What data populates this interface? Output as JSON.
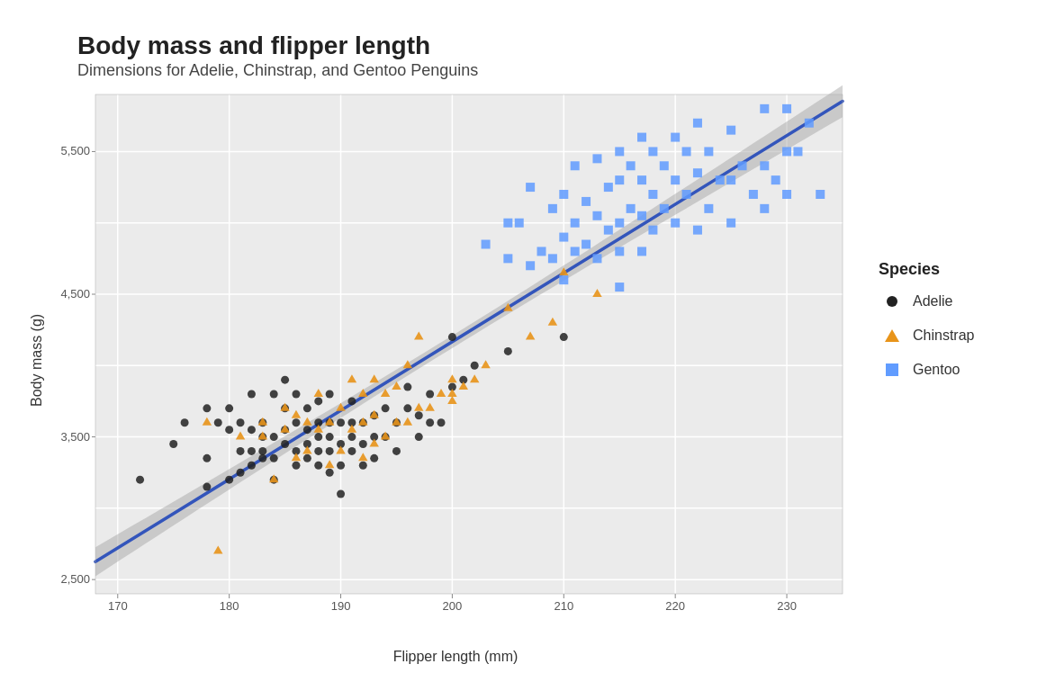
{
  "title": "Body mass and flipper length",
  "subtitle": "Dimensions for Adelie, Chinstrap, and Gentoo Penguins",
  "xAxisLabel": "Flipper length (mm)",
  "yAxisLabel": "Body mass (g)",
  "legendTitle": "Species",
  "legendItems": [
    {
      "label": "Adelie",
      "shape": "circle",
      "color": "#222222"
    },
    {
      "label": "Chinstrap",
      "shape": "triangle",
      "color": "#E8941A"
    },
    {
      "label": "Gentoo",
      "shape": "square",
      "color": "#619CFF"
    }
  ],
  "xTicks": [
    "170",
    "180",
    "190",
    "200",
    "210",
    "220",
    "230"
  ],
  "yTicks": [
    "2500",
    "3500",
    "4500",
    "5500"
  ],
  "colors": {
    "adelie": "#222222",
    "chinstrap": "#E8941A",
    "gentoo": "#619CFF",
    "trendline": "#3366CC",
    "ci": "rgba(150,150,150,0.4)",
    "gridBg": "#EBEBEB",
    "gridLine": "#ffffff"
  },
  "adeliePoints": [
    [
      172,
      3200
    ],
    [
      175,
      3450
    ],
    [
      176,
      3600
    ],
    [
      178,
      3150
    ],
    [
      178,
      3350
    ],
    [
      178,
      3700
    ],
    [
      179,
      3600
    ],
    [
      180,
      3200
    ],
    [
      180,
      3550
    ],
    [
      180,
      3700
    ],
    [
      181,
      3250
    ],
    [
      181,
      3400
    ],
    [
      181,
      3600
    ],
    [
      182,
      3300
    ],
    [
      182,
      3400
    ],
    [
      182,
      3550
    ],
    [
      182,
      3800
    ],
    [
      183,
      3350
    ],
    [
      183,
      3400
    ],
    [
      183,
      3500
    ],
    [
      183,
      3600
    ],
    [
      184,
      3200
    ],
    [
      184,
      3350
    ],
    [
      184,
      3500
    ],
    [
      184,
      3800
    ],
    [
      185,
      3450
    ],
    [
      185,
      3550
    ],
    [
      185,
      3700
    ],
    [
      185,
      3900
    ],
    [
      186,
      3300
    ],
    [
      186,
      3400
    ],
    [
      186,
      3600
    ],
    [
      186,
      3800
    ],
    [
      187,
      3350
    ],
    [
      187,
      3450
    ],
    [
      187,
      3550
    ],
    [
      187,
      3700
    ],
    [
      188,
      3300
    ],
    [
      188,
      3400
    ],
    [
      188,
      3500
    ],
    [
      188,
      3600
    ],
    [
      188,
      3750
    ],
    [
      189,
      3250
    ],
    [
      189,
      3400
    ],
    [
      189,
      3500
    ],
    [
      189,
      3600
    ],
    [
      189,
      3800
    ],
    [
      190,
      3100
    ],
    [
      190,
      3300
    ],
    [
      190,
      3450
    ],
    [
      190,
      3600
    ],
    [
      191,
      3400
    ],
    [
      191,
      3500
    ],
    [
      191,
      3600
    ],
    [
      191,
      3750
    ],
    [
      192,
      3300
    ],
    [
      192,
      3450
    ],
    [
      192,
      3600
    ],
    [
      193,
      3350
    ],
    [
      193,
      3500
    ],
    [
      193,
      3650
    ],
    [
      194,
      3500
    ],
    [
      194,
      3700
    ],
    [
      195,
      3400
    ],
    [
      195,
      3600
    ],
    [
      196,
      3700
    ],
    [
      196,
      3850
    ],
    [
      197,
      3500
    ],
    [
      197,
      3650
    ],
    [
      198,
      3600
    ],
    [
      198,
      3800
    ],
    [
      199,
      3600
    ],
    [
      200,
      4200
    ],
    [
      200,
      3850
    ],
    [
      201,
      3900
    ],
    [
      202,
      4000
    ],
    [
      205,
      4100
    ],
    [
      210,
      4200
    ]
  ],
  "chinStrapPoints": [
    [
      178,
      3600
    ],
    [
      179,
      2700
    ],
    [
      181,
      3500
    ],
    [
      183,
      3600
    ],
    [
      183,
      3500
    ],
    [
      184,
      3200
    ],
    [
      185,
      3550
    ],
    [
      185,
      3700
    ],
    [
      186,
      3350
    ],
    [
      186,
      3650
    ],
    [
      187,
      3400
    ],
    [
      187,
      3600
    ],
    [
      188,
      3550
    ],
    [
      188,
      3800
    ],
    [
      189,
      3300
    ],
    [
      189,
      3600
    ],
    [
      190,
      3400
    ],
    [
      190,
      3700
    ],
    [
      191,
      3550
    ],
    [
      191,
      3900
    ],
    [
      192,
      3350
    ],
    [
      192,
      3600
    ],
    [
      192,
      3800
    ],
    [
      193,
      3450
    ],
    [
      193,
      3650
    ],
    [
      193,
      3900
    ],
    [
      194,
      3500
    ],
    [
      194,
      3800
    ],
    [
      195,
      3600
    ],
    [
      195,
      3850
    ],
    [
      196,
      3600
    ],
    [
      196,
      4000
    ],
    [
      197,
      3700
    ],
    [
      197,
      4200
    ],
    [
      198,
      3700
    ],
    [
      199,
      3800
    ],
    [
      200,
      3750
    ],
    [
      200,
      3800
    ],
    [
      200,
      3900
    ],
    [
      201,
      3850
    ],
    [
      202,
      3900
    ],
    [
      203,
      4000
    ],
    [
      205,
      4400
    ],
    [
      207,
      4200
    ],
    [
      209,
      4300
    ],
    [
      210,
      4650
    ],
    [
      213,
      4500
    ]
  ],
  "gentooPoints": [
    [
      203,
      4850
    ],
    [
      205,
      5000
    ],
    [
      205,
      4750
    ],
    [
      206,
      5000
    ],
    [
      207,
      5250
    ],
    [
      207,
      4700
    ],
    [
      208,
      4800
    ],
    [
      209,
      5100
    ],
    [
      209,
      4750
    ],
    [
      210,
      4600
    ],
    [
      210,
      4900
    ],
    [
      210,
      5200
    ],
    [
      211,
      4800
    ],
    [
      211,
      5000
    ],
    [
      211,
      5400
    ],
    [
      212,
      4850
    ],
    [
      212,
      5150
    ],
    [
      213,
      4750
    ],
    [
      213,
      5050
    ],
    [
      213,
      5450
    ],
    [
      214,
      4950
    ],
    [
      214,
      5250
    ],
    [
      215,
      4800
    ],
    [
      215,
      5000
    ],
    [
      215,
      5300
    ],
    [
      215,
      5500
    ],
    [
      215,
      4550
    ],
    [
      216,
      5100
    ],
    [
      216,
      5400
    ],
    [
      217,
      4800
    ],
    [
      217,
      5050
    ],
    [
      217,
      5300
    ],
    [
      217,
      5600
    ],
    [
      218,
      4950
    ],
    [
      218,
      5200
    ],
    [
      218,
      5500
    ],
    [
      219,
      5100
    ],
    [
      219,
      5400
    ],
    [
      220,
      5000
    ],
    [
      220,
      5300
    ],
    [
      220,
      5600
    ],
    [
      221,
      5200
    ],
    [
      221,
      5500
    ],
    [
      222,
      4950
    ],
    [
      222,
      5350
    ],
    [
      222,
      5700
    ],
    [
      223,
      5100
    ],
    [
      223,
      5500
    ],
    [
      224,
      5300
    ],
    [
      225,
      5000
    ],
    [
      225,
      5300
    ],
    [
      225,
      5650
    ],
    [
      226,
      5400
    ],
    [
      227,
      5200
    ],
    [
      228,
      5100
    ],
    [
      228,
      5400
    ],
    [
      228,
      5800
    ],
    [
      229,
      5300
    ],
    [
      230,
      5200
    ],
    [
      230,
      5500
    ],
    [
      230,
      5800
    ],
    [
      231,
      5500
    ],
    [
      232,
      5700
    ],
    [
      233,
      5200
    ]
  ]
}
